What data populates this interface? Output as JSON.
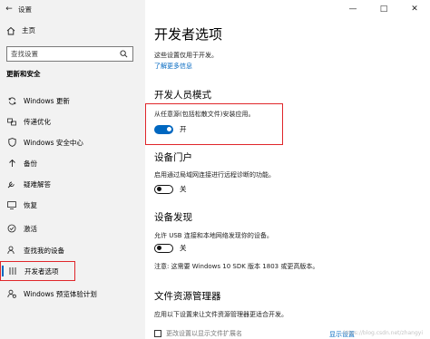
{
  "window": {
    "title": "设置",
    "controls": {
      "minimize": "—",
      "maximize": "□",
      "close": "✕"
    }
  },
  "sidebar": {
    "home_label": "主页",
    "search_placeholder": "查找设置",
    "section_title": "更新和安全",
    "items": [
      {
        "label": "Windows 更新",
        "icon": "sync-icon"
      },
      {
        "label": "传递优化",
        "icon": "delivery-icon"
      },
      {
        "label": "Windows 安全中心",
        "icon": "shield-icon"
      },
      {
        "label": "备份",
        "icon": "backup-icon"
      },
      {
        "label": "疑难解答",
        "icon": "wrench-icon"
      },
      {
        "label": "恢复",
        "icon": "recovery-icon"
      },
      {
        "label": "激活",
        "icon": "check-circle-icon"
      },
      {
        "label": "查找我的设备",
        "icon": "person-location-icon"
      },
      {
        "label": "开发者选项",
        "icon": "developer-icon"
      },
      {
        "label": "Windows 预览体验计划",
        "icon": "insider-icon"
      }
    ],
    "active_index": 8
  },
  "main": {
    "title": "开发者选项",
    "intro": "这些设置仅用于开发。",
    "learn_more": "了解更多信息",
    "dev_mode": {
      "title": "开发人员模式",
      "desc": "从任意源(包括松散文件)安装应用。",
      "toggle_state": "开",
      "on": true
    },
    "device_portal": {
      "title": "设备门户",
      "desc": "启用通过局域网连接进行远程诊断的功能。",
      "toggle_state": "关",
      "on": false
    },
    "device_discovery": {
      "title": "设备发现",
      "desc1": "允许 USB 连接和本地网络发现你的设备。",
      "toggle_state": "关",
      "on": false,
      "desc2": "注意: 这需要 Windows 10 SDK 版本 1803 或更高版本。"
    },
    "file_explorer": {
      "title": "文件资源管理器",
      "desc": "应用以下设置来让文件资源管理器更适合开发。",
      "checkbox_label": "更改设置以显示文件扩展名",
      "link": "显示设置"
    },
    "watermark": "https://blog.csdn.net/zhangyi"
  },
  "colors": {
    "accent": "#0067c0",
    "highlight": "#e0262a",
    "sidebar_bg": "#f2f2f2"
  }
}
